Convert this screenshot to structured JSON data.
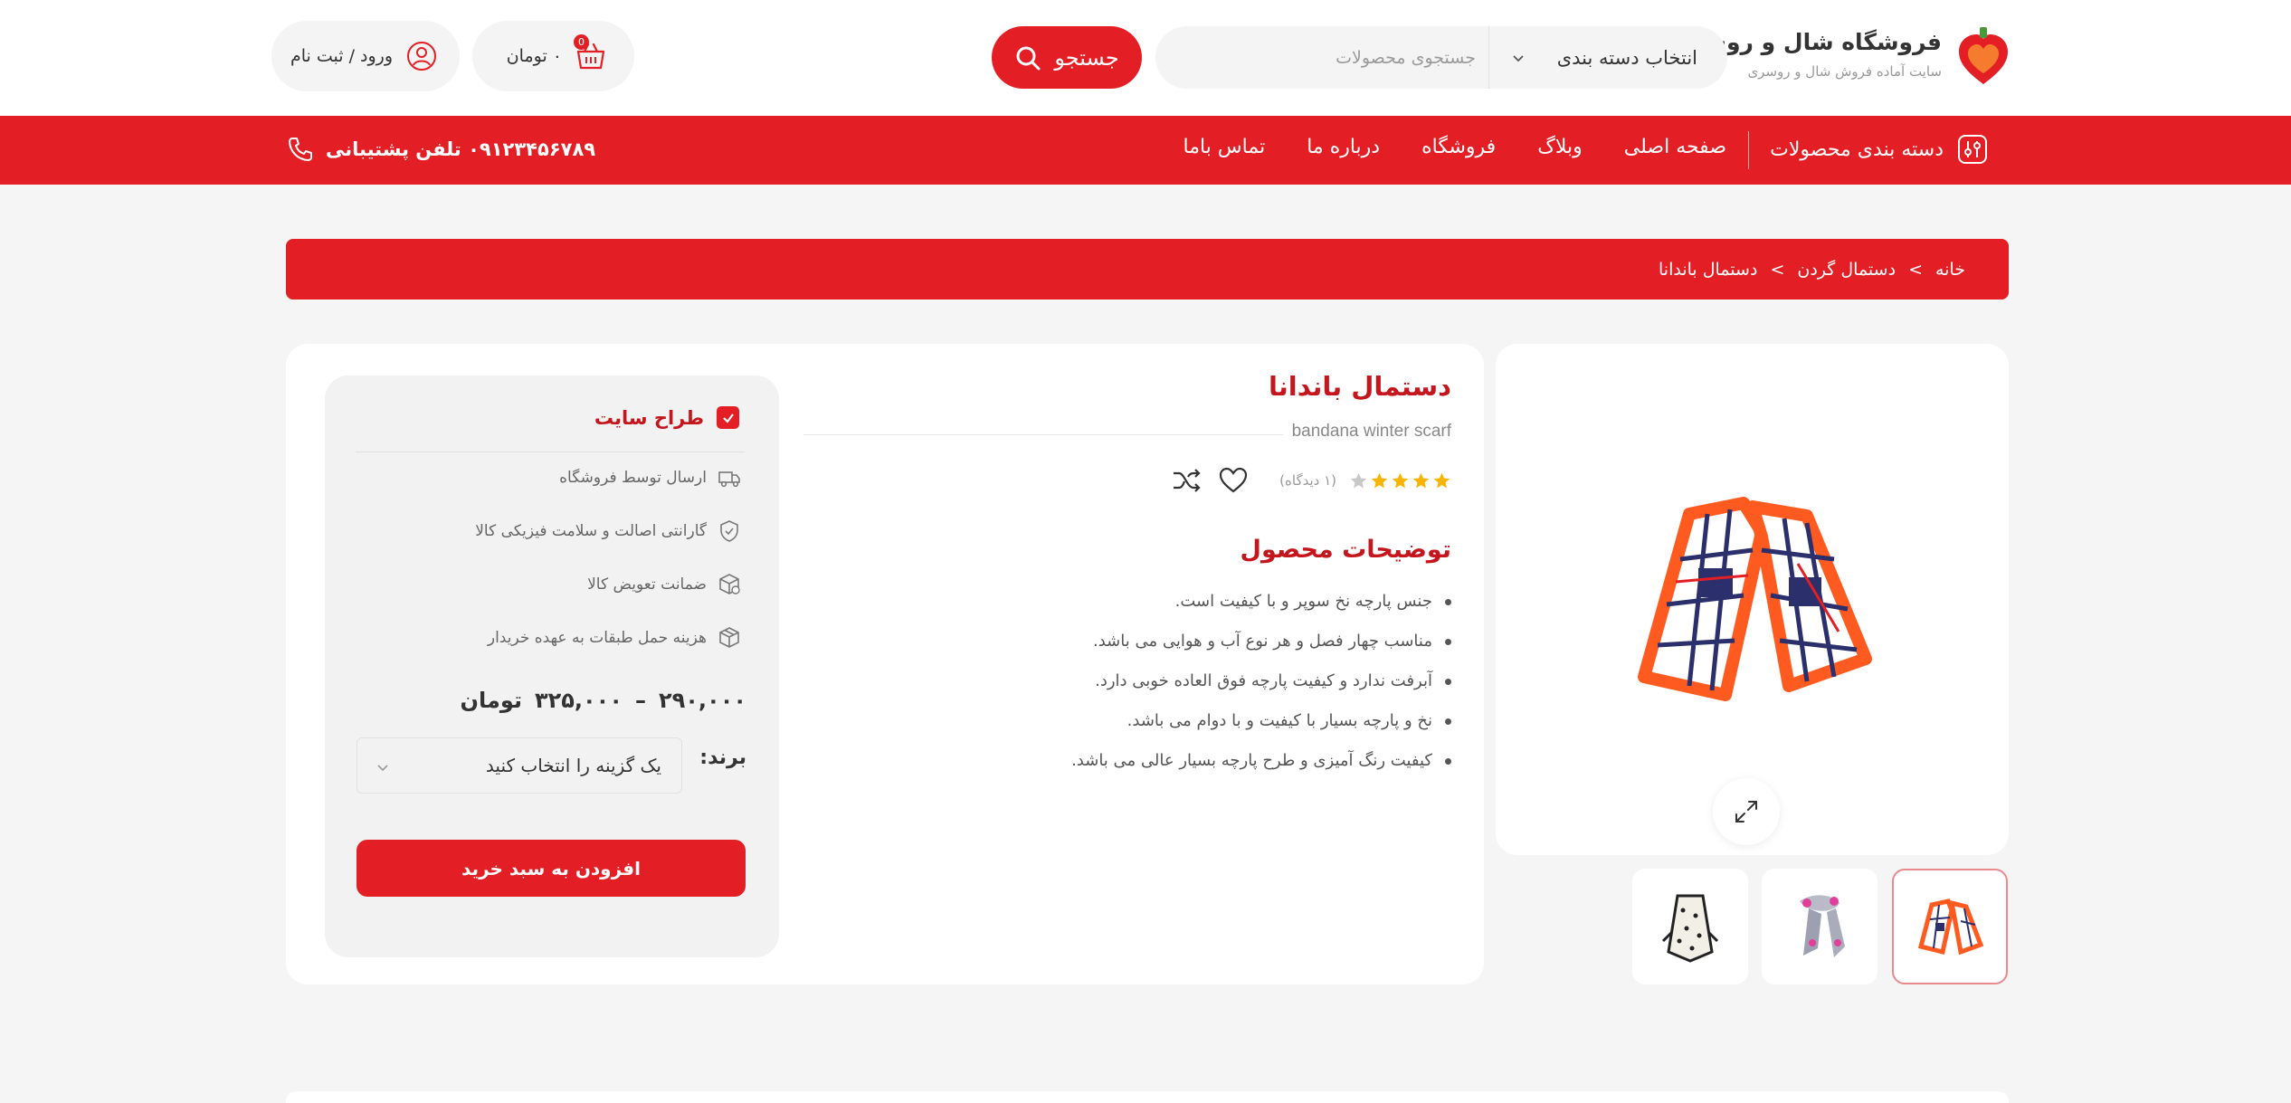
{
  "colors": {
    "accent": "#e31e24",
    "accent_dark": "#c4161c",
    "background": "#f5f5f5",
    "panel": "#ffffff",
    "box": "#f2f2f2"
  },
  "header": {
    "logo_icon": "heart-gift-icon",
    "site_title": "فروشگاه شال و روسری",
    "site_subtitle": "سایت آماده فروش شال و روسری",
    "category_select": "انتخاب دسته بندی",
    "search_placeholder": "جستجوی محصولات",
    "search_button": "جستجو",
    "cart_amount": "۰ تومان",
    "cart_count": "0",
    "login_label": "ورود / ثبت نام"
  },
  "nav": {
    "categories_label": "دسته بندی محصولات",
    "links": [
      "صفحه اصلی",
      "وبلاگ",
      "فروشگاه",
      "درباره ما",
      "تماس باما"
    ],
    "phone_label": "۰۹۱۲۳۴۵۶۷۸۹ تلفن پشتیبانی"
  },
  "breadcrumb": {
    "items": [
      "خانه",
      "دستمال گردن",
      "دستمال باندانا"
    ],
    "separator": ">"
  },
  "product": {
    "title": "دستمال باندانا",
    "subtitle_en": "bandana winter scarf",
    "rating": 4,
    "rating_max": 5,
    "review_count": "(۱ دیدگاه)",
    "description_title": "توضیحات محصول",
    "description": [
      "جنس پارچه نخ سوپر و با کیفیت است.",
      "مناسب چهار فصل و هر نوع آب و هوایی می باشد.",
      "آبرفت ندارد و کیفیت پارچه فوق العاده خوبی دارد.",
      "نخ و پارچه بسیار با کیفیت و با دوام می باشد.",
      "کیفیت رنگ آمیزی و طرح پارچه بسیار عالی می باشد."
    ]
  },
  "side": {
    "seller": "طراح سایت",
    "features": [
      "ارسال توسط فروشگاه",
      "گارانتی اصالت و سلامت فیزیکی کالا",
      "ضمانت تعویض کالا",
      "هزینه حمل طبقات به عهده خریدار"
    ],
    "price_low": "۲۹۰,۰۰۰",
    "price_dash": "–",
    "price_high": "۳۲۵,۰۰۰",
    "currency": "تومان",
    "brand_label": "برند:",
    "brand_select": "یک گزینه را انتخاب کنید",
    "add_to_cart": "افزودن به سبد خرید"
  }
}
